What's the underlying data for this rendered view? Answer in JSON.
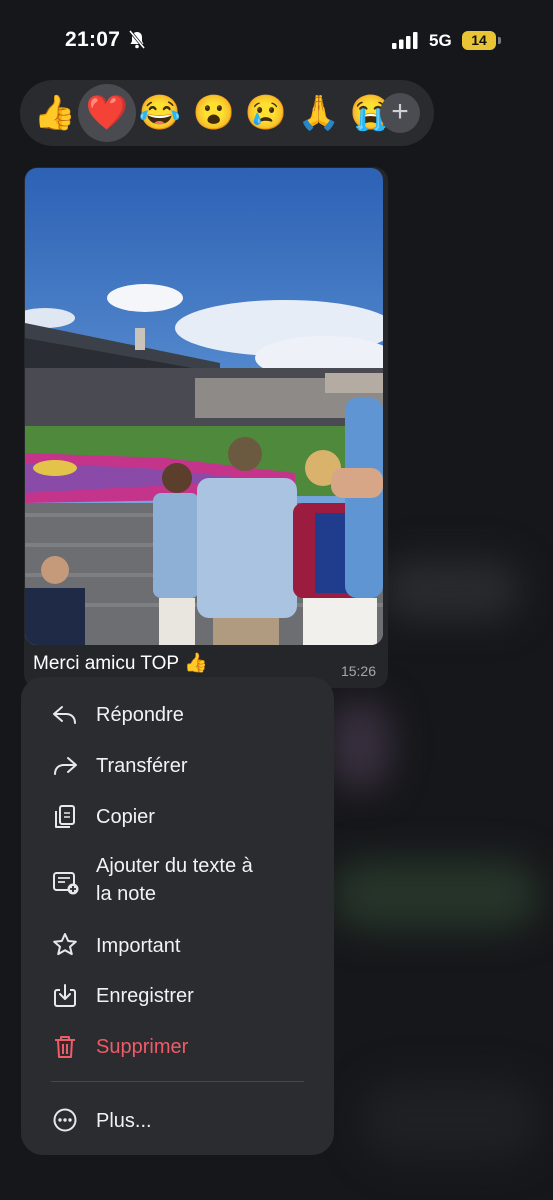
{
  "status_bar": {
    "time": "21:07",
    "network": "5G",
    "battery": "14"
  },
  "reactions": {
    "items": [
      {
        "name": "thumbs-up",
        "emoji": "👍"
      },
      {
        "name": "heart",
        "emoji": "❤️",
        "selected": true
      },
      {
        "name": "laughing",
        "emoji": "😂"
      },
      {
        "name": "surprised",
        "emoji": "😮"
      },
      {
        "name": "crying",
        "emoji": "😢"
      },
      {
        "name": "praying",
        "emoji": "🙏"
      },
      {
        "name": "sobbing",
        "emoji": "😭"
      }
    ],
    "add_label": "+"
  },
  "message": {
    "caption": "Merci amicu TOP 👍",
    "time": "15:26"
  },
  "menu": {
    "items": [
      {
        "label": "Répondre",
        "icon": "reply-icon"
      },
      {
        "label": "Transférer",
        "icon": "forward-icon"
      },
      {
        "label": "Copier",
        "icon": "copy-icon"
      },
      {
        "label": "Ajouter du texte à",
        "label2": "la note",
        "icon": "add-to-note-icon"
      },
      {
        "label": "Important",
        "icon": "star-icon"
      },
      {
        "label": "Enregistrer",
        "icon": "save-icon"
      },
      {
        "label": "Supprimer",
        "icon": "trash-icon",
        "danger": true
      },
      {
        "label": "Plus...",
        "icon": "more-icon"
      }
    ]
  },
  "colors": {
    "danger": "#ef5b66",
    "menu_bg": "#2b2c30",
    "battery": "#e9c435"
  }
}
